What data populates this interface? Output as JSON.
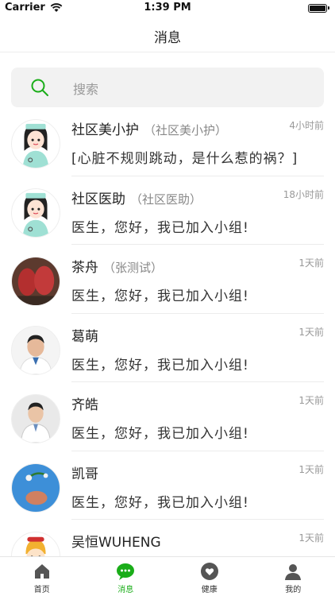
{
  "status_bar": {
    "carrier": "Carrier",
    "time": "1:39 PM"
  },
  "nav": {
    "title": "消息"
  },
  "search": {
    "placeholder": "搜索"
  },
  "messages": [
    {
      "name": "社区美小护",
      "subname": "（社区美小护）",
      "text": "[心脏不规则跳动，是什么惹的祸？]",
      "time": "4小时前",
      "avatar": "nurse"
    },
    {
      "name": "社区医助",
      "subname": "（社区医助）",
      "text": "医生，您好，我已加入小组!",
      "time": "18小时前",
      "avatar": "nurse"
    },
    {
      "name": "茶舟",
      "subname": "（张测试）",
      "text": "医生，您好，我已加入小组!",
      "time": "1天前",
      "avatar": "photo-red"
    },
    {
      "name": "葛萌",
      "subname": "",
      "text": "医生，您好，我已加入小组!",
      "time": "1天前",
      "avatar": "doctor"
    },
    {
      "name": "齐皓",
      "subname": "",
      "text": "医生，您好，我已加入小组!",
      "time": "1天前",
      "avatar": "doctor2"
    },
    {
      "name": "凯哥",
      "subname": "",
      "text": "医生，您好，我已加入小组!",
      "time": "1天前",
      "avatar": "photo-blue"
    },
    {
      "name": "吴恒WUHENG",
      "subname": "",
      "text": "",
      "time": "1天前",
      "avatar": "cartoon"
    }
  ],
  "tabbar": {
    "items": [
      {
        "label": "首页",
        "icon": "home-icon"
      },
      {
        "label": "消息",
        "icon": "chat-icon"
      },
      {
        "label": "健康",
        "icon": "heart-icon"
      },
      {
        "label": "我的",
        "icon": "user-icon"
      }
    ],
    "active_index": 1
  },
  "colors": {
    "accent": "#1aad19",
    "avatar_nurse_bg": "#ffffff",
    "avatar_blue": "#3d8fd8",
    "avatar_red": "#b03030"
  }
}
